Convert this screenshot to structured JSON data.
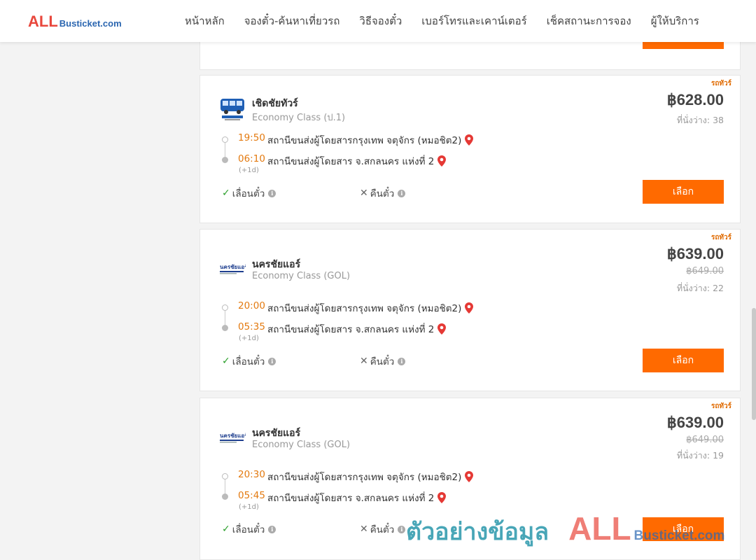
{
  "header": {
    "logo_all": "ALL",
    "logo_bus": "Busticket.com",
    "nav": [
      "หน้าหลัก",
      "จองตั๋ว-ค้นหาเที่ยวรถ",
      "วิธีจองตั๋ว",
      "เบอร์โทรและเคาน์เตอร์",
      "เช็คสถานะการจอง",
      "ผู้ให้บริการ"
    ]
  },
  "colors": {
    "accent": "#ff6a00",
    "time": "#e37a10",
    "check": "#2ca02c",
    "pin": "#e53935"
  },
  "trips": [
    {
      "badge": "รถทัวร์",
      "operator": "เชิดชัยทัวร์",
      "class": "Economy Class (ป.1)",
      "price": "฿628.00",
      "old_price": "",
      "seats": "ที่นั่งว่าง: 38",
      "depart_time": "19:50",
      "depart_station": "สถานีขนส่งผู้โดยสารกรุงเทพ จตุจักร (หมอชิต2)",
      "arrive_time": "06:10",
      "arrive_station": "สถานีขนส่งผู้โดยสาร จ.สกลนคร แห่งที่ 2",
      "plus_day": "(+1d)",
      "reschedule": "เลื่อนตั๋ว",
      "refund": "คืนตั๋ว",
      "select": "เลือก",
      "logo_icon": "bus-logo-icon"
    },
    {
      "badge": "รถทัวร์",
      "operator": "นครชัยแอร์",
      "class": "Economy Class (GOL)",
      "price": "฿639.00",
      "old_price": "฿649.00",
      "seats": "ที่นั่งว่าง: 22",
      "depart_time": "20:00",
      "depart_station": "สถานีขนส่งผู้โดยสารกรุงเทพ จตุจักร (หมอชิต2)",
      "arrive_time": "05:35",
      "arrive_station": "สถานีขนส่งผู้โดยสาร จ.สกลนคร แห่งที่ 2",
      "plus_day": "(+1d)",
      "reschedule": "เลื่อนตั๋ว",
      "refund": "คืนตั๋ว",
      "select": "เลือก",
      "logo_icon": "nakhonchai-logo-icon"
    },
    {
      "badge": "รถทัวร์",
      "operator": "นครชัยแอร์",
      "class": "Economy Class (GOL)",
      "price": "฿639.00",
      "old_price": "฿649.00",
      "seats": "ที่นั่งว่าง: 19",
      "depart_time": "20:30",
      "depart_station": "สถานีขนส่งผู้โดยสารกรุงเทพ จตุจักร (หมอชิต2)",
      "arrive_time": "05:45",
      "arrive_station": "สถานีขนส่งผู้โดยสาร จ.สกลนคร แห่งที่ 2",
      "plus_day": "(+1d)",
      "reschedule": "เลื่อนตั๋ว",
      "refund": "คืนตั๋ว",
      "select": "เลือก",
      "logo_icon": "nakhonchai-logo-icon"
    }
  ],
  "watermark": {
    "text": "ตัวอย่างข้อมูล",
    "all": "ALL",
    "bus": "Busticket.com"
  }
}
